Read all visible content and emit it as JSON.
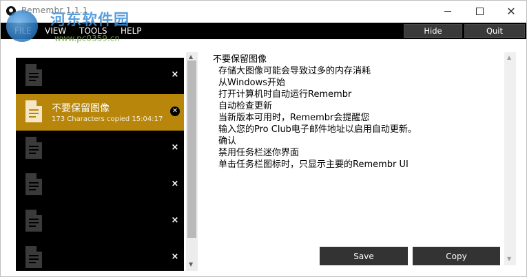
{
  "window": {
    "title": "Remembr 1.1.1",
    "controls": {
      "minimize": "—",
      "maximize": "☐",
      "close": "✕"
    }
  },
  "watermark": {
    "main": "河东软件园",
    "sub": "www.pc0359.cn"
  },
  "menu": {
    "file": "FILE",
    "view": "VIEW",
    "tools": "TOOLS",
    "help": "HELP"
  },
  "topbar": {
    "hide_label": "Hide",
    "quit_label": "Quit"
  },
  "list": {
    "close_glyph": "×",
    "selected_close_glyph": "✕",
    "items": [
      {
        "title": "",
        "subtitle": "",
        "selected": false
      },
      {
        "title": "不要保留图像",
        "subtitle": "173 Characters copied 15:04:17",
        "selected": true
      },
      {
        "title": "",
        "subtitle": "",
        "selected": false
      },
      {
        "title": "",
        "subtitle": "",
        "selected": false
      },
      {
        "title": "",
        "subtitle": "",
        "selected": false
      },
      {
        "title": "",
        "subtitle": "",
        "selected": false
      }
    ]
  },
  "content": {
    "lines": [
      "不要保留图像",
      "存储大图像可能会导致过多的内存消耗",
      "从Windows开始",
      "打开计算机时自动运行Remembr",
      "自动检查更新",
      "当新版本可用时，Remembr会提醒您",
      "输入您的Pro Club电子邮件地址以启用自动更新。",
      "确认",
      "禁用任务栏迷你界面",
      "单击任务栏图标时，只显示主要的Remembr UI"
    ]
  },
  "actions": {
    "save_label": "Save",
    "copy_label": "Copy"
  },
  "scroll": {
    "up": "▲",
    "down": "▼"
  },
  "colors": {
    "selected_item": "#b8860b",
    "menubar": "#000000",
    "button": "#333333"
  }
}
